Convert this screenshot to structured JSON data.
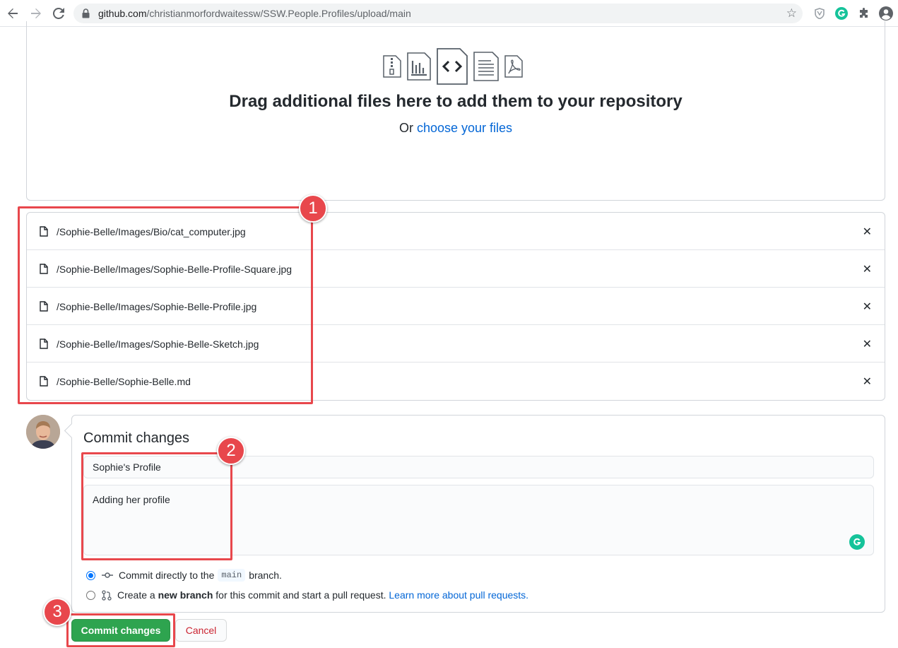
{
  "browser": {
    "url_host": "github.com",
    "url_path": "/christianmorfordwaitessw/SSW.People.Profiles/upload/main"
  },
  "dropzone": {
    "title": "Drag additional files here to add them to your repository",
    "or_text": "Or ",
    "choose_link": "choose your files",
    "icons": [
      "zip-file-icon",
      "chart-file-icon",
      "code-file-icon",
      "text-file-icon",
      "pdf-file-icon"
    ]
  },
  "files": [
    "/Sophie-Belle/Images/Bio/cat_computer.jpg",
    "/Sophie-Belle/Images/Sophie-Belle-Profile-Square.jpg",
    "/Sophie-Belle/Images/Sophie-Belle-Profile.jpg",
    "/Sophie-Belle/Images/Sophie-Belle-Sketch.jpg",
    "/Sophie-Belle/Sophie-Belle.md"
  ],
  "commit": {
    "title": "Commit changes",
    "summary_value": "Sophie's Profile",
    "description_value": "Adding her profile",
    "option_direct_prefix": "Commit directly to the",
    "option_direct_branch": "main",
    "option_direct_suffix": "branch.",
    "option_new_prefix": "Create a",
    "option_new_bold": "new branch",
    "option_new_suffix": "for this commit and start a pull request.",
    "option_new_link": "Learn more about pull requests.",
    "commit_button": "Commit changes",
    "cancel_button": "Cancel"
  },
  "annotations": {
    "badge1": "1",
    "badge2": "2",
    "badge3": "3",
    "color": "#e8474c"
  },
  "colors": {
    "primary_button": "#2ea44f",
    "link": "#0366d6",
    "cancel_text": "#cb2431"
  }
}
